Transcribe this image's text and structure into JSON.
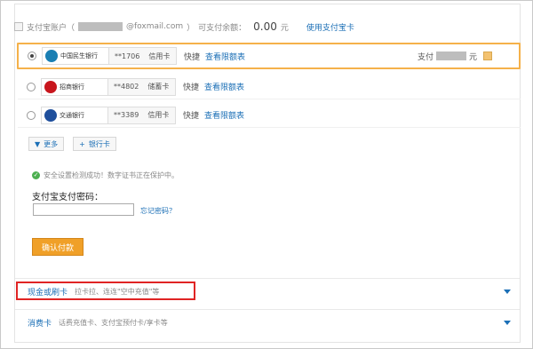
{
  "balance_row": {
    "label": "支付宝账户（",
    "email_suffix": "@foxmail.com",
    "closing_paren": "）",
    "available_label": "可支付余额：",
    "amount": "0.00",
    "currency": "元",
    "use_link": "使用支付宝卡"
  },
  "banks": [
    {
      "name": "中国民生银行",
      "card_no": "**1706",
      "card_type": "信用卡",
      "quick": "快捷",
      "limit_link": "查看限额表",
      "brand_color": "#1a7fb3",
      "selected": true
    },
    {
      "name": "招商银行",
      "card_no": "**4802",
      "card_type": "储蓄卡",
      "quick": "快捷",
      "limit_link": "查看限额表",
      "brand_color": "#c8161d",
      "selected": false
    },
    {
      "name": "交通银行",
      "card_no": "**3389",
      "card_type": "信用卡",
      "quick": "快捷",
      "limit_link": "查看限额表",
      "brand_color": "#1f4f9c",
      "selected": false
    }
  ],
  "pay_summary": {
    "label": "支付",
    "currency": "元"
  },
  "buttons": {
    "more": "更多",
    "add_card": "银行卡"
  },
  "security_note": "安全设置检测成功！数字证书正在保护中。",
  "password": {
    "label": "支付宝支付密码：",
    "forgot_link": "忘记密码？"
  },
  "confirm_button": "确认付款",
  "methods": [
    {
      "title": "现金或刷卡",
      "desc": "拉卡拉、连连\"空中充值\"等"
    },
    {
      "title": "消费卡",
      "desc": "话费充值卡、支付宝预付卡/享卡等"
    }
  ],
  "colors": {
    "accent": "#f0a028",
    "link": "#1b6fb6",
    "highlight": "#e02424",
    "selected_border": "#f5b14a"
  },
  "icons": {
    "check": "check-circle-icon",
    "caret": "caret-down-icon",
    "plus": "plus-icon",
    "chevron": "chevron-down-icon"
  }
}
